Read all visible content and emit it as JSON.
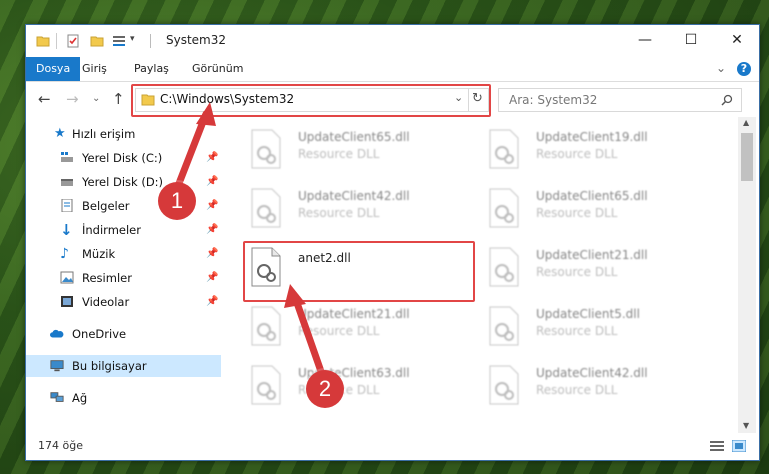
{
  "window": {
    "title": "System32",
    "controls": {
      "minimize": "—",
      "maximize": "☐",
      "close": "✕"
    }
  },
  "ribbon": {
    "tabs": [
      "Dosya",
      "Giriş",
      "Paylaş",
      "Görünüm"
    ],
    "help": "?"
  },
  "navigation": {
    "address": "C:\\Windows\\System32",
    "search_placeholder": "Ara: System32"
  },
  "sidebar": {
    "quick_access": "Hızlı erişim",
    "items": [
      {
        "label": "Yerel Disk (C:)"
      },
      {
        "label": "Yerel Disk (D:)"
      },
      {
        "label": "Belgeler"
      },
      {
        "label": "İndirmeler"
      },
      {
        "label": "Müzik"
      },
      {
        "label": "Resimler"
      },
      {
        "label": "Videolar"
      }
    ],
    "onedrive": "OneDrive",
    "this_pc": "Bu bilgisayar",
    "network": "Ağ"
  },
  "files": [
    {
      "name": "UpdateClient65.dll",
      "type": "Resource DLL"
    },
    {
      "name": "UpdateClient19.dll",
      "type": "Resource DLL"
    },
    {
      "name": "UpdateClient42.dll",
      "type": "Resource DLL"
    },
    {
      "name": "UpdateClient65.dll",
      "type": "Resource DLL"
    },
    {
      "name": "anet2.dll",
      "type": ""
    },
    {
      "name": "UpdateClient21.dll",
      "type": "Resource DLL"
    },
    {
      "name": "UpdateClient21.dll",
      "type": "Resource DLL"
    },
    {
      "name": "UpdateClient5.dll",
      "type": "Resource DLL"
    },
    {
      "name": "UpdateClient63.dll",
      "type": "Resource DLL"
    },
    {
      "name": "UpdateClient42.dll",
      "type": "Resource DLL"
    }
  ],
  "status": {
    "count": "174 öğe"
  },
  "annotations": {
    "marker1": "1",
    "marker2": "2"
  },
  "colors": {
    "accent": "#1979ca",
    "highlight": "#e24646",
    "selection": "#cce8ff"
  }
}
